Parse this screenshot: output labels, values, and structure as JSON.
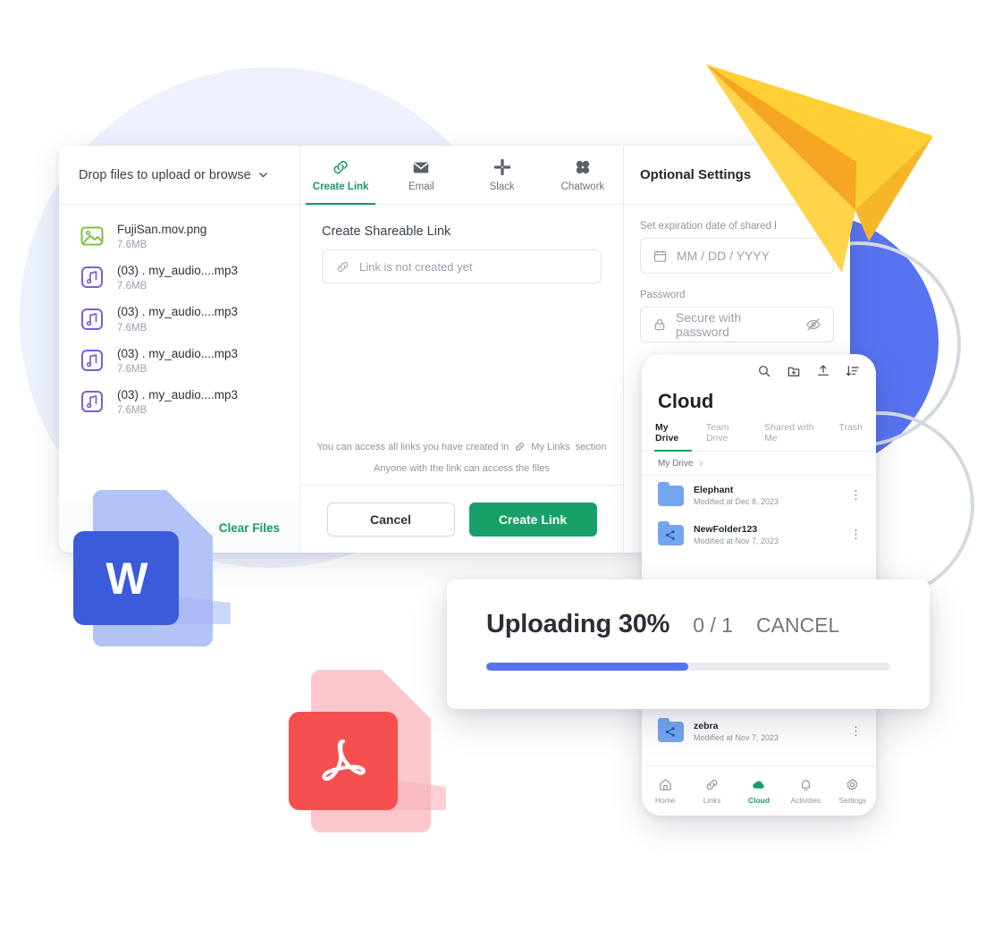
{
  "background": {
    "pale_circle_color": "#EDF1FD",
    "blue_circle_color": "#5773F0",
    "ring_color": "#D5D9E0"
  },
  "desktop_window": {
    "files_pane": {
      "drop_header_label": "Drop files to upload or browse",
      "dropdown_icon": "chevron-down-icon",
      "clear_files_label": "Clear Files",
      "files": [
        {
          "name": "FujiSan.mov.png",
          "size": "7.6MB",
          "icon": "image-file-icon",
          "icon_color": "#7DC242"
        },
        {
          "name": "(03) . my_audio....mp3",
          "size": "7.6MB",
          "icon": "audio-file-icon",
          "icon_color": "#7C5CE0"
        },
        {
          "name": "(03) . my_audio....mp3",
          "size": "7.6MB",
          "icon": "audio-file-icon",
          "icon_color": "#7C5CE0"
        },
        {
          "name": "(03) . my_audio....mp3",
          "size": "7.6MB",
          "icon": "audio-file-icon",
          "icon_color": "#7C5CE0"
        },
        {
          "name": "(03) . my_audio....mp3",
          "size": "7.6MB",
          "icon": "audio-file-icon",
          "icon_color": "#7C5CE0"
        }
      ]
    },
    "tabs": [
      {
        "label": "Create Link",
        "icon": "link-icon",
        "active": true
      },
      {
        "label": "Email",
        "icon": "envelope-icon",
        "active": false
      },
      {
        "label": "Slack",
        "icon": "slack-icon",
        "active": false
      },
      {
        "label": "Chatwork",
        "icon": "chatwork-icon",
        "active": false
      }
    ],
    "active_tab_color": "#179A64",
    "main": {
      "section_title": "Create Shareable Link",
      "link_field": {
        "placeholder": "Link is not created yet",
        "icon": "link-icon"
      },
      "note_prefix": "You can access all links you have created in",
      "note_link_label": "My Links",
      "note_suffix": "section",
      "note_secondary": "Anyone with the link can access the files",
      "cancel_label": "Cancel",
      "create_label": "Create Link",
      "create_button_color": "#17A06A"
    },
    "optional_settings": {
      "title": "Optional Settings",
      "expiration_label": "Set expiration date of shared l",
      "expiration_placeholder": "MM / DD / YYYY",
      "expiration_icon": "calendar-icon",
      "password_label": "Password",
      "password_placeholder": "Secure with password",
      "password_icon": "lock-icon",
      "password_toggle_icon": "eye-off-icon"
    }
  },
  "mobile_app": {
    "toolbar_icons": [
      "search-icon",
      "new-folder-icon",
      "upload-icon",
      "sort-icon"
    ],
    "title": "Cloud",
    "tabs": [
      {
        "label": "My Drive",
        "active": true
      },
      {
        "label": "Team Drive",
        "active": false
      },
      {
        "label": "Shared with Me",
        "active": false
      },
      {
        "label": "Trash",
        "active": false
      }
    ],
    "breadcrumb": "My Drive",
    "breadcrumb_chevron": "chevron-right-icon",
    "items": [
      {
        "name": "Elephant",
        "meta": "Modified at Dec 8, 2023",
        "icon": "folder-icon",
        "menu_icon": "kebab-menu-icon"
      },
      {
        "name": "NewFolder123",
        "meta": "Modified at Nov 7, 2023",
        "icon": "shared-folder-icon",
        "menu_icon": "kebab-menu-icon"
      },
      {
        "name": "zebra",
        "meta": "Modified at Nov 7, 2023",
        "icon": "shared-folder-icon",
        "menu_icon": "kebab-menu-icon"
      }
    ],
    "nav": [
      {
        "label": "Home",
        "icon": "home-icon",
        "active": false
      },
      {
        "label": "Links",
        "icon": "link-icon",
        "active": false
      },
      {
        "label": "Cloud",
        "icon": "cloud-icon",
        "active": true
      },
      {
        "label": "Activities",
        "icon": "bell-icon",
        "active": false
      },
      {
        "label": "Settings",
        "icon": "gear-icon",
        "active": false
      }
    ],
    "active_nav_color": "#17A06A"
  },
  "upload_toast": {
    "title": "Uploading 30%",
    "count": "0 / 1",
    "cancel_label": "CANCEL",
    "progress_percent": 50,
    "bar_color": "#5773F0",
    "track_color": "#E9EBEF"
  },
  "illustrations": {
    "word_doc": {
      "name": "word-document-icon",
      "letter": "W",
      "page_color": "#B3C2F7",
      "badge_color": "#3B5BDB"
    },
    "pdf_doc": {
      "name": "pdf-document-icon",
      "page_color": "#FBC7CC",
      "badge_color": "#F5504F"
    },
    "paper_plane": {
      "name": "paper-plane-icon",
      "main_color": "#FFCF33",
      "shade_color": "#F5A623"
    }
  }
}
